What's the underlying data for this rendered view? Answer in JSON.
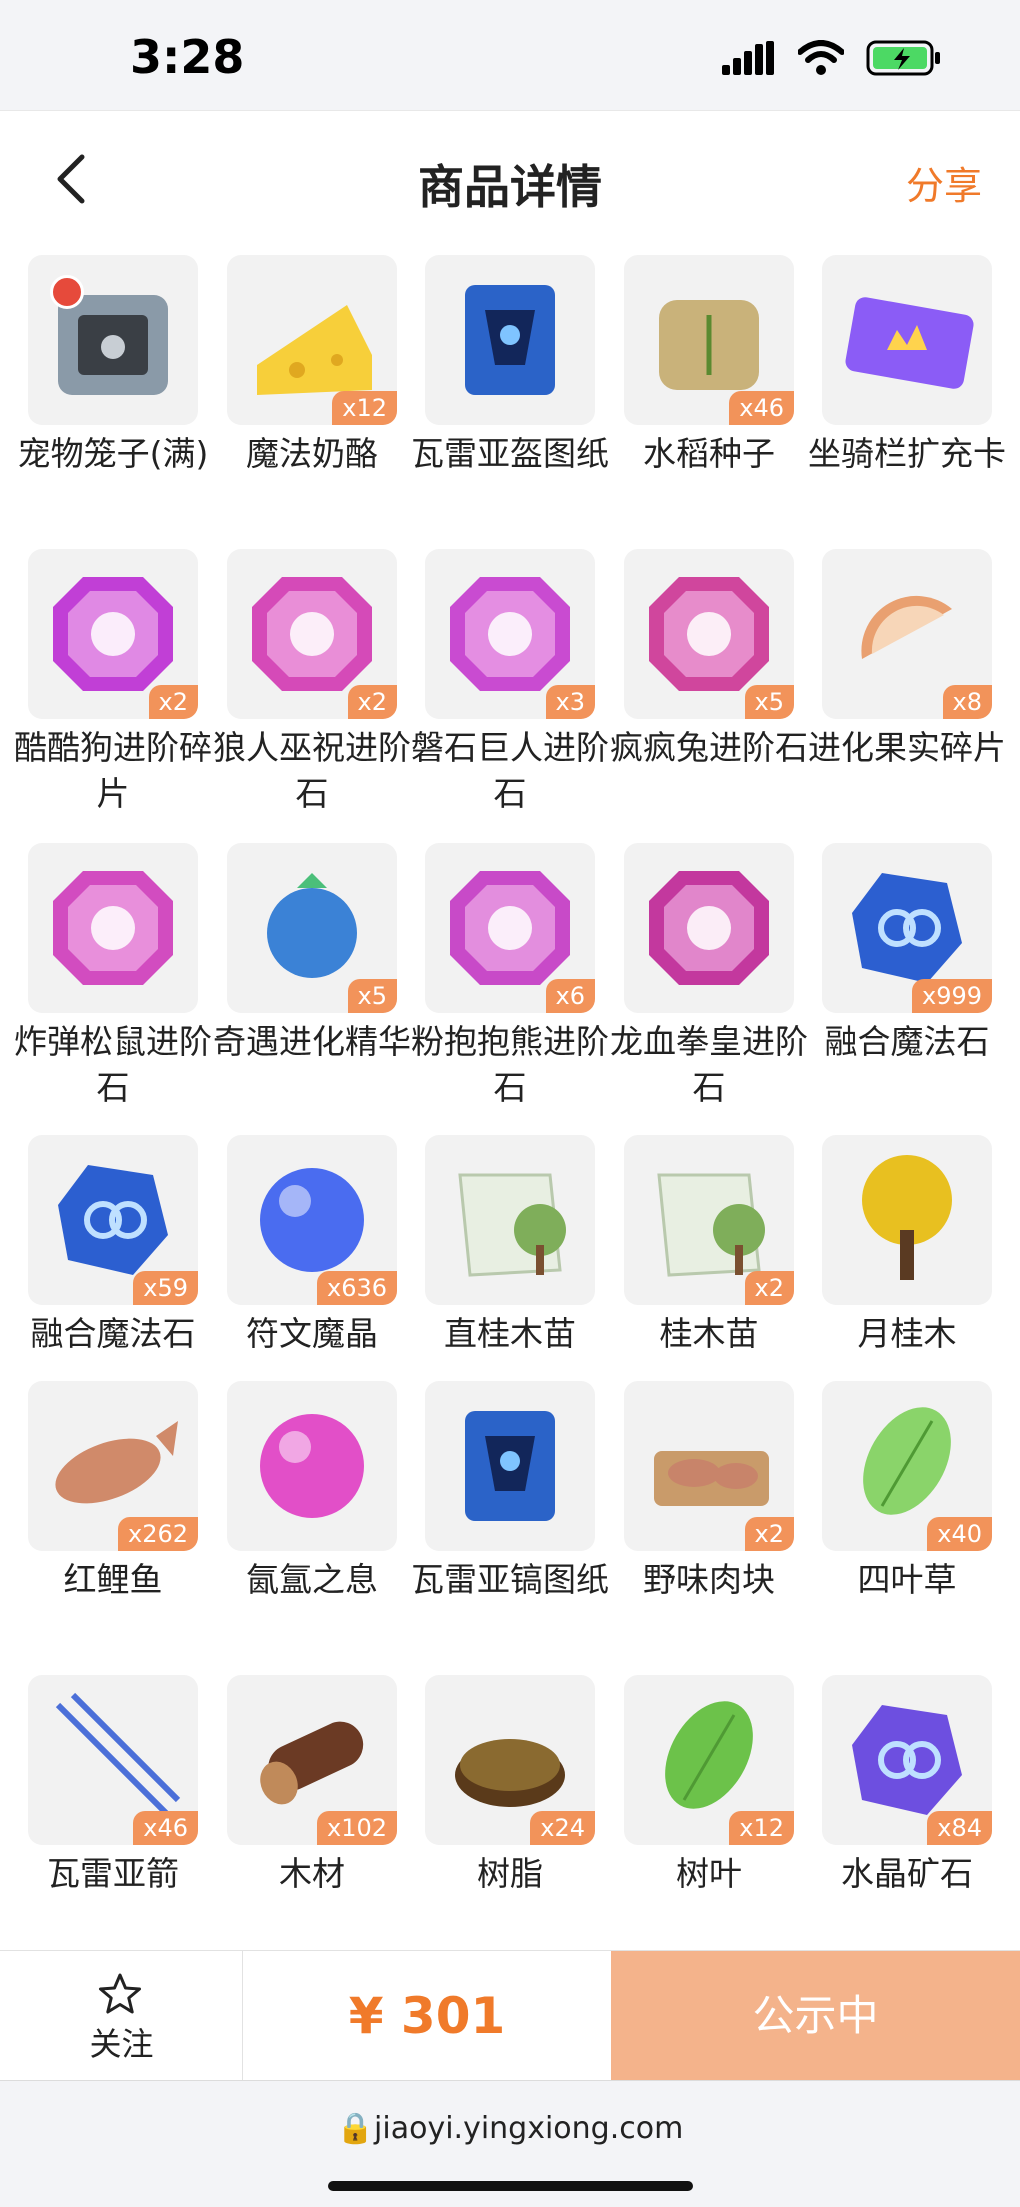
{
  "status_bar": {
    "time": "3:28"
  },
  "nav": {
    "title": "商品详情",
    "share_label": "分享"
  },
  "items": [
    {
      "name": "宠物笼子(满)",
      "qty": "",
      "icon": "pet-cage-icon",
      "color": "#8a9aa8"
    },
    {
      "name": "魔法奶酪",
      "qty": "x12",
      "icon": "cheese-icon",
      "color": "#f7cf3a"
    },
    {
      "name": "瓦雷亚盔图纸",
      "qty": "",
      "icon": "helmet-scroll-icon",
      "color": "#2b63c8"
    },
    {
      "name": "水稻种子",
      "qty": "x46",
      "icon": "rice-seed-bag-icon",
      "color": "#c9b27a"
    },
    {
      "name": "坐骑栏扩充卡",
      "qty": "",
      "icon": "mount-card-icon",
      "color": "#8b5cf6"
    },
    {
      "name": "酷酷狗进阶碎片",
      "qty": "x2",
      "icon": "dog-gem-icon",
      "color": "#c13fd6"
    },
    {
      "name": "狼人巫祝进阶石",
      "qty": "x2",
      "icon": "werewolf-gem-icon",
      "color": "#d54ab8"
    },
    {
      "name": "磐石巨人进阶石",
      "qty": "x3",
      "icon": "giant-gem-icon",
      "color": "#c94bd1"
    },
    {
      "name": "疯疯兔进阶石",
      "qty": "x5",
      "icon": "rabbit-gem-icon",
      "color": "#d0469d"
    },
    {
      "name": "进化果实碎片",
      "qty": "x8",
      "icon": "fruit-shard-icon",
      "color": "#e9a070"
    },
    {
      "name": "炸弹松鼠进阶石",
      "qty": "",
      "icon": "squirrel-gem-icon",
      "color": "#d24cc0"
    },
    {
      "name": "奇遇进化精华",
      "qty": "x5",
      "icon": "blueberry-essence-icon",
      "color": "#3b82d6"
    },
    {
      "name": "粉抱抱熊进阶石",
      "qty": "x6",
      "icon": "bear-gem-icon",
      "color": "#c84ac8"
    },
    {
      "name": "龙血拳皇进阶石",
      "qty": "",
      "icon": "dragon-gem-icon",
      "color": "#c3389e"
    },
    {
      "name": "融合魔法石",
      "qty": "x999",
      "icon": "fusion-stone-icon",
      "color": "#2c5fd0"
    },
    {
      "name": "融合魔法石",
      "qty": "x59",
      "icon": "fusion-stone-icon",
      "color": "#2c5fd0"
    },
    {
      "name": "符文魔晶",
      "qty": "x636",
      "icon": "rune-crystal-icon",
      "color": "#4a6cf0"
    },
    {
      "name": "直桂木苗",
      "qty": "",
      "icon": "sapling-pack-icon",
      "color": "#7fae5a"
    },
    {
      "name": "桂木苗",
      "qty": "x2",
      "icon": "sapling-pack-icon",
      "color": "#7fae5a"
    },
    {
      "name": "月桂木",
      "qty": "",
      "icon": "laurel-tree-icon",
      "color": "#e8c020"
    },
    {
      "name": "红鲤鱼",
      "qty": "x262",
      "icon": "fish-icon",
      "color": "#d08a6a"
    },
    {
      "name": "氤氲之息",
      "qty": "",
      "icon": "pink-orb-icon",
      "color": "#e24fc8"
    },
    {
      "name": "瓦雷亚镐图纸",
      "qty": "",
      "icon": "pickaxe-scroll-icon",
      "color": "#2b63c8"
    },
    {
      "name": "野味肉块",
      "qty": "x2",
      "icon": "meat-icon",
      "color": "#c8846a"
    },
    {
      "name": "四叶草",
      "qty": "x40",
      "icon": "clover-icon",
      "color": "#8ad46a"
    },
    {
      "name": "瓦雷亚箭",
      "qty": "x46",
      "icon": "arrow-icon",
      "color": "#4b6fd8"
    },
    {
      "name": "木材",
      "qty": "x102",
      "icon": "log-icon",
      "color": "#6b3a24"
    },
    {
      "name": "树脂",
      "qty": "x24",
      "icon": "resin-icon",
      "color": "#8a6a30"
    },
    {
      "name": "树叶",
      "qty": "x12",
      "icon": "leaf-icon",
      "color": "#6cc24a"
    },
    {
      "name": "水晶矿石",
      "qty": "x84",
      "icon": "crystal-ore-icon",
      "color": "#6d4fe0"
    }
  ],
  "bottom": {
    "follow_label": "关注",
    "price": "¥ 301",
    "cta_label": "公示中"
  },
  "url_bar": {
    "url": "jiaoyi.yingxiong.com"
  }
}
